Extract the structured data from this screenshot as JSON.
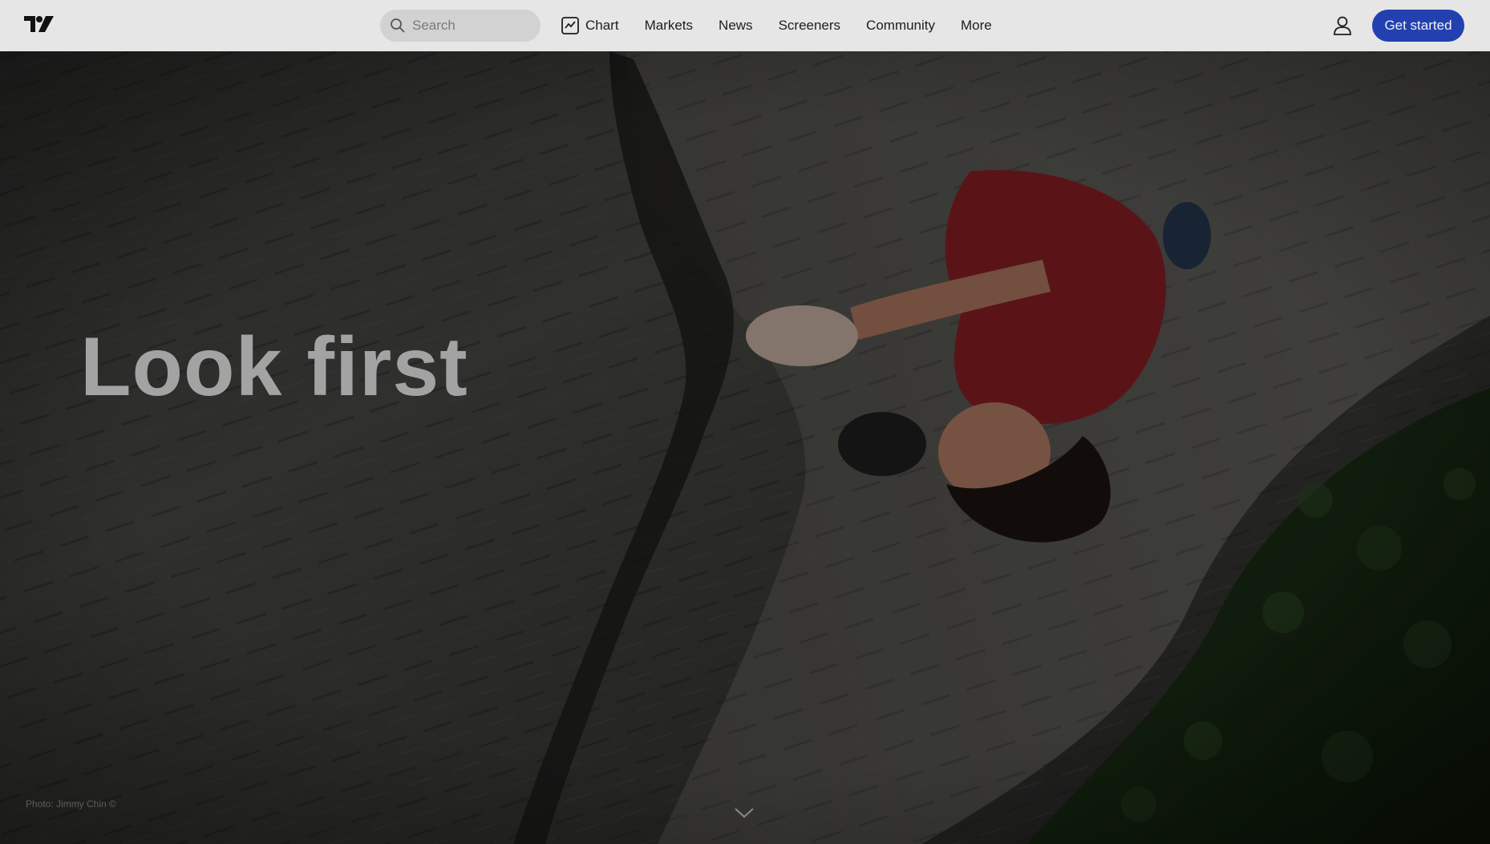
{
  "header": {
    "logo_icon": "tradingview-logo-icon",
    "search": {
      "placeholder": "Search",
      "icon": "search-icon"
    },
    "nav": [
      {
        "label": "Chart",
        "icon": "chart-icon"
      },
      {
        "label": "Markets"
      },
      {
        "label": "News"
      },
      {
        "label": "Screeners"
      },
      {
        "label": "Community"
      },
      {
        "label": "More"
      }
    ],
    "user_icon": "user-icon",
    "cta_label": "Get started"
  },
  "hero": {
    "title": "Look first",
    "photo_credit": "Photo: Jimmy Chin ©",
    "scroll_icon": "chevron-down-icon"
  },
  "colors": {
    "header_bg": "#e6e6e6",
    "cta_bg": "#2340b0",
    "title": "#a3a3a3",
    "shirt": "#8a1f26"
  }
}
